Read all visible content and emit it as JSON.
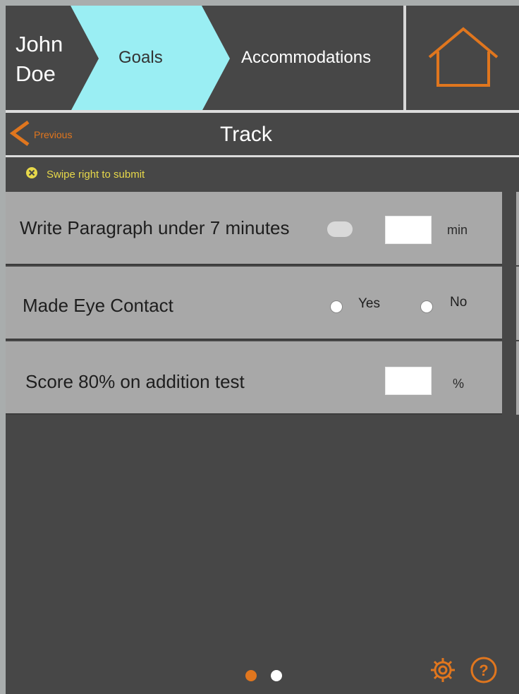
{
  "header": {
    "student_name": "John Doe",
    "crumbs": [
      {
        "label": "Goals",
        "active": true
      },
      {
        "label": "Accommodations",
        "active": false
      }
    ],
    "home_icon": "home-icon"
  },
  "titlebar": {
    "previous_label": "Previous",
    "title": "Track"
  },
  "hint": {
    "icon": "close-circle-icon",
    "text": "Swipe right to submit"
  },
  "goals": [
    {
      "label": "Write Paragraph under 7 minutes",
      "type": "number",
      "unit": "min",
      "value": ""
    },
    {
      "label": "Made Eye Contact",
      "type": "yes-no",
      "options": [
        "Yes",
        "No"
      ],
      "selected": null
    },
    {
      "label": "Score 80% on addition test",
      "type": "number",
      "unit": "%",
      "value": ""
    }
  ],
  "pagination": {
    "pages": 2,
    "current": 1
  },
  "footer_icons": [
    "gear-icon",
    "help-icon"
  ],
  "colors": {
    "accent": "#e0761e",
    "active_crumb": "#9aeef3",
    "background": "#474747",
    "row": "#a8a8a8",
    "hint_text": "#e7d84a"
  }
}
